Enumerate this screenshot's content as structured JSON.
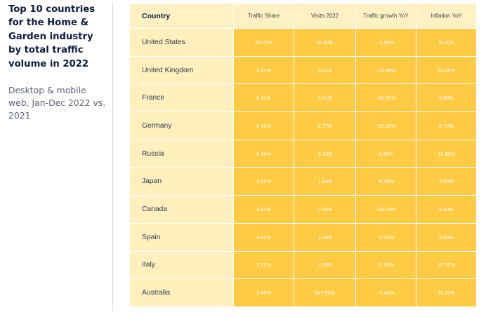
{
  "side_panel": {
    "title": "Top 10 countries for the Home & Garden industry by total traffic volume in 2022",
    "subtitle": "Desktop & mobile web, Jan-Dec 2022 vs. 2021"
  },
  "colors": {
    "header_background": "#fff1c4",
    "country_column_background": "#fff0bd",
    "value_cell_background": "#ffcb45",
    "value_text": "#ffffff",
    "title_text": "#0d1b3e"
  },
  "chart_data": {
    "type": "table",
    "columns": [
      "Country",
      "Traffic Share",
      "Visits 2022",
      "Traffic growth YoY",
      "Inflation YoY"
    ],
    "rows": [
      [
        "United States",
        "30.70%",
        "11.92B",
        "-5.65%",
        "6.41%"
      ],
      [
        "United Kingdom",
        "8.41%",
        "3.27B",
        "-14.48%",
        "10.05%"
      ],
      [
        "France",
        "6.21%",
        "2.41B",
        "-14.51%",
        "5.89%"
      ],
      [
        "Germany",
        "6.10%",
        "2.37B",
        "-12.33%",
        "8.70%"
      ],
      [
        "Russia",
        "5.74%",
        "2.23B",
        "6.46%",
        "11.80%"
      ],
      [
        "Japan",
        "4.22%",
        "1.64B",
        "-8.28%",
        "4.00%"
      ],
      [
        "Canada",
        "3.92%",
        "1.52B",
        "-15.15%",
        "5.90%"
      ],
      [
        "Spain",
        "2.82%",
        "1.09B",
        "-3.46%",
        "5.89%"
      ],
      [
        "Italy",
        "2.72%",
        "1.06B",
        "-2.50%",
        "10.70%"
      ],
      [
        "Australia",
        "2.49%",
        "967.95M",
        "-5.44%",
        "11.10%"
      ]
    ]
  }
}
